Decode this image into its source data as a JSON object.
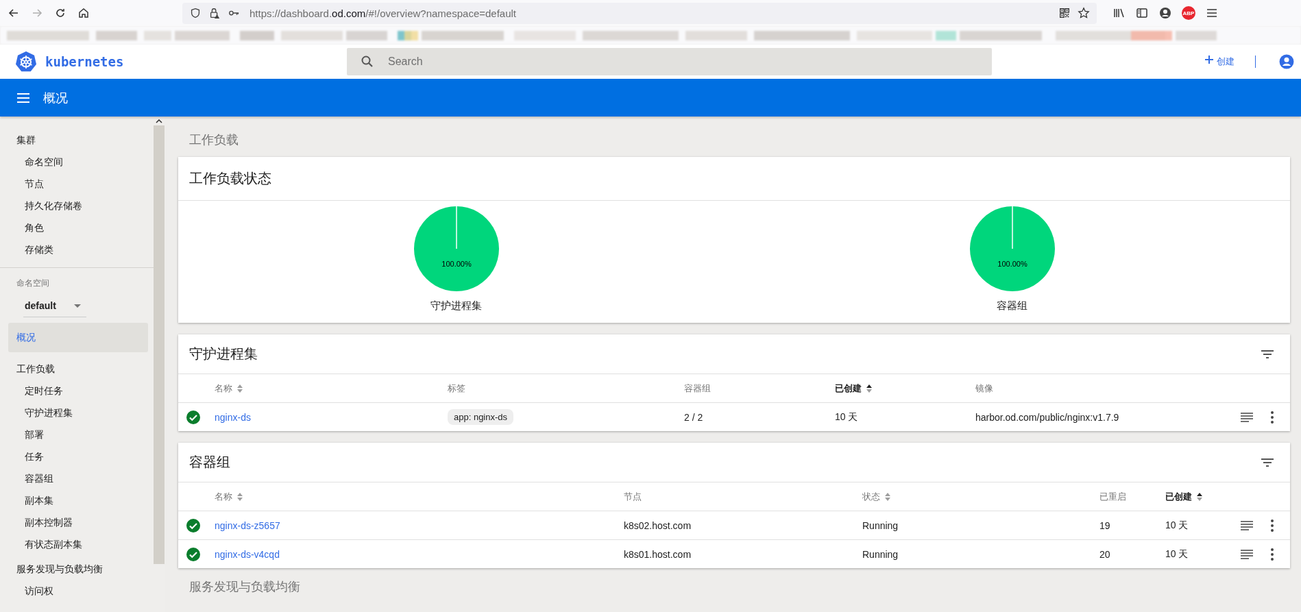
{
  "browser": {
    "url": {
      "before": "https://dashboard.",
      "domain": "od.com",
      "after": "/#!/overview?namespace=default"
    },
    "forward_disabled": true,
    "adblock_badge": "ABP"
  },
  "header": {
    "brand": "kubernetes",
    "search": {
      "placeholder": "Search"
    },
    "create": "创建"
  },
  "title_bar": {
    "title": "概况"
  },
  "sidebar": {
    "top_items": [
      {
        "label": "集群",
        "selected": false,
        "children": [
          {
            "label": "命名空间",
            "selected": false
          },
          {
            "label": "节点",
            "selected": false
          },
          {
            "label": "持久化存储卷",
            "selected": false
          },
          {
            "label": "角色",
            "selected": false
          },
          {
            "label": "存储类",
            "selected": false
          }
        ]
      }
    ],
    "namespace": {
      "label": "命名空间",
      "value": "default"
    },
    "items": [
      {
        "label": "概况",
        "selected": true
      },
      {
        "label": "工作负载",
        "selected": false,
        "children": [
          {
            "label": "定时任务",
            "selected": false
          },
          {
            "label": "守护进程集",
            "selected": false
          },
          {
            "label": "部署",
            "selected": false
          },
          {
            "label": "任务",
            "selected": false
          },
          {
            "label": "容器组",
            "selected": false
          },
          {
            "label": "副本集",
            "selected": false
          },
          {
            "label": "副本控制器",
            "selected": false
          },
          {
            "label": "有状态副本集",
            "selected": false
          }
        ]
      },
      {
        "label": "服务发现与负载均衡",
        "selected": false,
        "children": [
          {
            "label": "访问权",
            "selected": false
          }
        ]
      }
    ]
  },
  "content": {
    "section_title": "工作负载",
    "footer_title": "服务发现与负载均衡",
    "status_card": {
      "title": "工作负载状态",
      "charts": [
        {
          "label": "守护进程集",
          "level": 1,
          "percent": "100.00%"
        },
        {
          "label": "容器组",
          "level": 1,
          "percent": "100.00%"
        }
      ]
    },
    "tables": [
      {
        "title": "守护进程集",
        "columns": [
          {
            "label": "名称",
            "sortable": true,
            "sorted": false
          },
          {
            "label": "标签",
            "sortable": false,
            "sorted": false
          },
          {
            "label": "容器组",
            "sortable": false,
            "sorted": false
          },
          {
            "label": "已创建",
            "sortable": true,
            "sorted": true
          },
          {
            "label": "镜像",
            "sortable": false,
            "sorted": false
          }
        ],
        "rows": [
          {
            "healthy": true,
            "cells": [
              {
                "kind": "link",
                "text": "nginx-ds"
              },
              {
                "kind": "chip",
                "text": "app: nginx-ds"
              },
              {
                "kind": "text",
                "text": "2 / 2"
              },
              {
                "kind": "text",
                "text": "10 天"
              },
              {
                "kind": "text",
                "text": "harbor.od.com/public/nginx:v1.7.9"
              }
            ]
          }
        ]
      },
      {
        "title": "容器组",
        "columns": [
          {
            "label": "名称",
            "sortable": true,
            "sorted": false
          },
          {
            "label": "节点",
            "sortable": false,
            "sorted": false
          },
          {
            "label": "状态",
            "sortable": true,
            "sorted": false
          },
          {
            "label": "已重启",
            "sortable": false,
            "sorted": false
          },
          {
            "label": "已创建",
            "sortable": true,
            "sorted": true
          }
        ],
        "rows": [
          {
            "healthy": true,
            "cells": [
              {
                "kind": "link",
                "text": "nginx-ds-z5657"
              },
              {
                "kind": "text",
                "text": "k8s02.host.com"
              },
              {
                "kind": "text",
                "text": "Running"
              },
              {
                "kind": "text",
                "text": "19"
              },
              {
                "kind": "text",
                "text": "10 天"
              }
            ]
          },
          {
            "healthy": true,
            "cells": [
              {
                "kind": "link",
                "text": "nginx-ds-v4cqd"
              },
              {
                "kind": "text",
                "text": "k8s01.host.com"
              },
              {
                "kind": "text",
                "text": "Running"
              },
              {
                "kind": "text",
                "text": "20"
              },
              {
                "kind": "text",
                "text": "10 天"
              }
            ]
          }
        ]
      }
    ]
  }
}
